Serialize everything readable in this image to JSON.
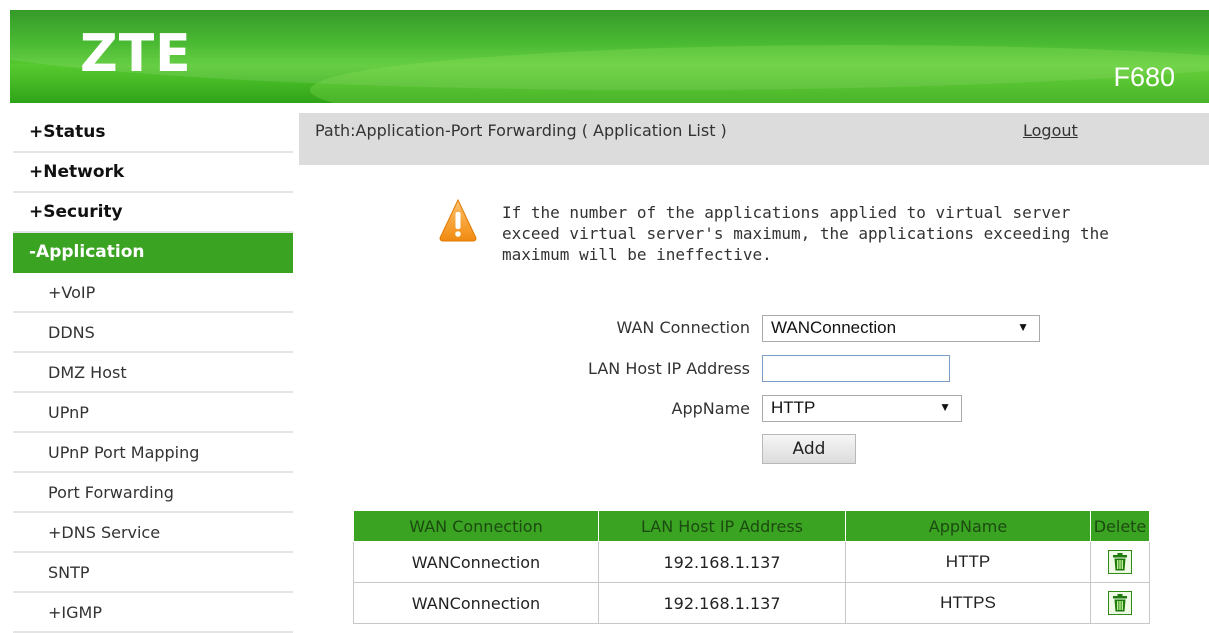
{
  "header": {
    "logo": "ZTE",
    "model": "F680",
    "brand_color": "#3aa322"
  },
  "sidebar": {
    "items": [
      {
        "label": "+Status",
        "level": "top",
        "active": false
      },
      {
        "label": "+Network",
        "level": "top",
        "active": false
      },
      {
        "label": "+Security",
        "level": "top",
        "active": false
      },
      {
        "label": "-Application",
        "level": "top",
        "active": true
      },
      {
        "label": "+VoIP",
        "level": "sub"
      },
      {
        "label": "DDNS",
        "level": "sub"
      },
      {
        "label": "DMZ Host",
        "level": "sub"
      },
      {
        "label": "UPnP",
        "level": "sub"
      },
      {
        "label": "UPnP Port Mapping",
        "level": "sub"
      },
      {
        "label": "Port Forwarding",
        "level": "sub"
      },
      {
        "label": "+DNS Service",
        "level": "sub"
      },
      {
        "label": "SNTP",
        "level": "sub"
      },
      {
        "label": "+IGMP",
        "level": "sub"
      }
    ]
  },
  "pathbar": {
    "path": "Path:Application-Port Forwarding ( Application List )",
    "logout": "Logout"
  },
  "warning": {
    "icon": "warning-icon",
    "text": "If the number of the applications applied to virtual server exceed virtual server's maximum, the applications exceeding the maximum will be ineffective."
  },
  "form": {
    "wan_label": "WAN Connection",
    "wan_value": "WANConnection",
    "lan_label": "LAN Host IP Address",
    "lan_value": "",
    "app_label": "AppName",
    "app_value": "HTTP",
    "add_label": "Add"
  },
  "table": {
    "headers": [
      "WAN Connection",
      "LAN Host IP Address",
      "AppName",
      "Delete"
    ],
    "rows": [
      {
        "wan": "WANConnection",
        "ip": "192.168.1.137",
        "app": "HTTP"
      },
      {
        "wan": "WANConnection",
        "ip": "192.168.1.137",
        "app": "HTTPS"
      }
    ]
  }
}
